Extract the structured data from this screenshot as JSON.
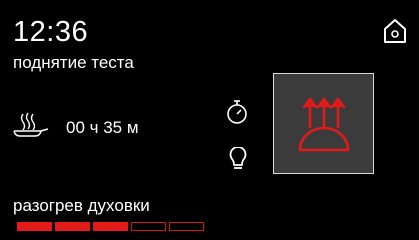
{
  "header": {
    "time": "12:36",
    "mode_name": "поднятие теста",
    "home_icon": "house-icon"
  },
  "cooking": {
    "duration": "00 ч 35 м",
    "steam_icon": "steam-pan-icon"
  },
  "side_buttons": {
    "timer_icon": "stopwatch-icon",
    "light_icon": "lightbulb-icon"
  },
  "heat_mode": {
    "icon": "top-heat-icon",
    "accent_color": "#e21a1a"
  },
  "preheat": {
    "label": "разогрев духовки",
    "segments_total": 5,
    "segments_done": 3,
    "progress": 0.6
  }
}
